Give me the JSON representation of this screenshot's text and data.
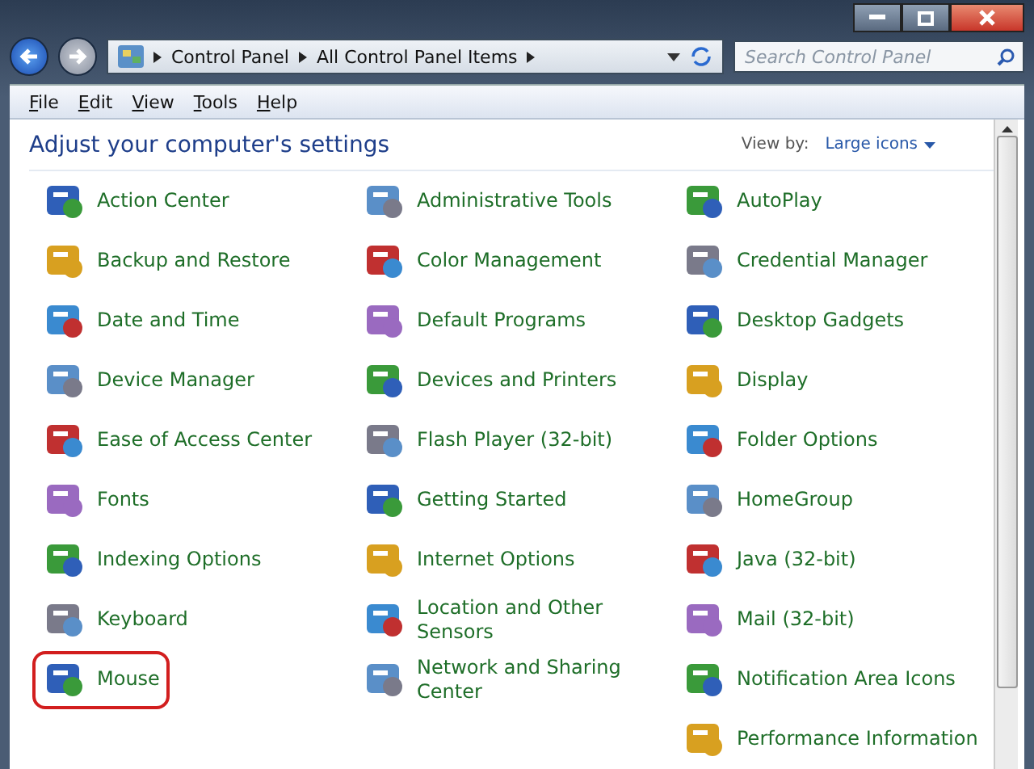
{
  "address_bar": {
    "breadcrumbs": [
      "Control Panel",
      "All Control Panel Items"
    ]
  },
  "search": {
    "placeholder": "Search Control Panel"
  },
  "menu": [
    "File",
    "Edit",
    "View",
    "Tools",
    "Help"
  ],
  "heading": "Adjust your computer's settings",
  "view_by": {
    "label": "View by:",
    "value": "Large icons"
  },
  "items": [
    {
      "label": "Action Center",
      "highlighted": false
    },
    {
      "label": "Administrative Tools",
      "highlighted": false
    },
    {
      "label": "AutoPlay",
      "highlighted": false
    },
    {
      "label": "Backup and Restore",
      "highlighted": false
    },
    {
      "label": "Color Management",
      "highlighted": false
    },
    {
      "label": "Credential Manager",
      "highlighted": false
    },
    {
      "label": "Date and Time",
      "highlighted": false
    },
    {
      "label": "Default Programs",
      "highlighted": false
    },
    {
      "label": "Desktop Gadgets",
      "highlighted": false
    },
    {
      "label": "Device Manager",
      "highlighted": false
    },
    {
      "label": "Devices and Printers",
      "highlighted": false
    },
    {
      "label": "Display",
      "highlighted": false
    },
    {
      "label": "Ease of Access Center",
      "highlighted": false
    },
    {
      "label": "Flash Player (32-bit)",
      "highlighted": false
    },
    {
      "label": "Folder Options",
      "highlighted": false
    },
    {
      "label": "Fonts",
      "highlighted": false
    },
    {
      "label": "Getting Started",
      "highlighted": false
    },
    {
      "label": "HomeGroup",
      "highlighted": false
    },
    {
      "label": "Indexing Options",
      "highlighted": false
    },
    {
      "label": "Internet Options",
      "highlighted": false
    },
    {
      "label": "Java (32-bit)",
      "highlighted": false
    },
    {
      "label": "Keyboard",
      "highlighted": false
    },
    {
      "label": "Location and Other Sensors",
      "highlighted": false
    },
    {
      "label": "Mail (32-bit)",
      "highlighted": false
    },
    {
      "label": "Mouse",
      "highlighted": true
    },
    {
      "label": "Network and Sharing Center",
      "highlighted": false
    },
    {
      "label": "Notification Area Icons",
      "highlighted": false
    },
    {
      "label": "Performance Information",
      "highlighted": false
    }
  ]
}
